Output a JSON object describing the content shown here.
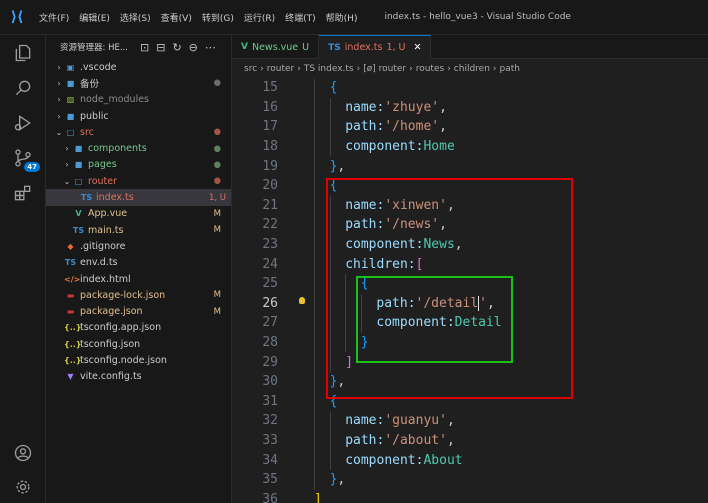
{
  "titlebar": {
    "menu": [
      "文件(F)",
      "编辑(E)",
      "选择(S)",
      "查看(V)",
      "转到(G)",
      "运行(R)",
      "终端(T)",
      "帮助(H)"
    ],
    "title": "index.ts - hello_vue3 - Visual Studio Code"
  },
  "activity_bar": {
    "items": [
      "explorer-icon",
      "search-icon",
      "run-debug-icon",
      "source-control-icon",
      "extensions-icon",
      "account-icon",
      "settings-gear-icon"
    ],
    "scm_badge": "47"
  },
  "explorer": {
    "title": "资源管理器: HE...",
    "items": [
      {
        "depth": 1,
        "chevron": "›",
        "icon": "▣",
        "icon_color": "#4e9bd4",
        "label": ".vscode",
        "label_color": "#cccccc",
        "status": "",
        "status_color": "#cccccc"
      },
      {
        "depth": 1,
        "chevron": "›",
        "icon": "■",
        "icon_color": "#4e9bd4",
        "label": "备份",
        "label_color": "#cccccc",
        "status": "●",
        "status_color": "#6b6b6b"
      },
      {
        "depth": 1,
        "chevron": "›",
        "icon": "▨",
        "icon_color": "#8dc149",
        "label": "node_modules",
        "label_color": "#8c8c8c",
        "status": "",
        "status_color": "#cccccc"
      },
      {
        "depth": 1,
        "chevron": "›",
        "icon": "■",
        "icon_color": "#4e9bd4",
        "label": "public",
        "label_color": "#cccccc",
        "status": "",
        "status_color": "#cccccc"
      },
      {
        "depth": 1,
        "chevron": "⌄",
        "icon": "□",
        "icon_color": "#4e9bd4",
        "label": "src",
        "label_color": "#e2705f",
        "status": "●",
        "status_color": "#a0534a"
      },
      {
        "depth": 2,
        "chevron": "›",
        "icon": "■",
        "icon_color": "#4e9bd4",
        "label": "components",
        "label_color": "#73c991",
        "status": "●",
        "status_color": "#5f7f5f"
      },
      {
        "depth": 2,
        "chevron": "›",
        "icon": "■",
        "icon_color": "#4e9bd4",
        "label": "pages",
        "label_color": "#73c991",
        "status": "●",
        "status_color": "#5f7f5f"
      },
      {
        "depth": 2,
        "chevron": "⌄",
        "icon": "□",
        "icon_color": "#4e9bd4",
        "label": "router",
        "label_color": "#e2705f",
        "status": "●",
        "status_color": "#a0534a"
      },
      {
        "depth": 3,
        "chevron": "",
        "icon": "TS",
        "icon_color": "#3c8ccf",
        "label": "index.ts",
        "label_color": "#e2705f",
        "status": "1, U",
        "status_color": "#e2705f",
        "selected": true
      },
      {
        "depth": 2,
        "chevron": "",
        "icon": "V",
        "icon_color": "#41b883",
        "label": "App.vue",
        "label_color": "#e2c08d",
        "status": "M",
        "status_color": "#e2c08d"
      },
      {
        "depth": 2,
        "chevron": "",
        "icon": "TS",
        "icon_color": "#3c8ccf",
        "label": "main.ts",
        "label_color": "#e2c08d",
        "status": "M",
        "status_color": "#e2c08d"
      },
      {
        "depth": 1,
        "chevron": "",
        "icon": "◆",
        "icon_color": "#e8683a",
        "label": ".gitignore",
        "label_color": "#cccccc",
        "status": "",
        "status_color": "#cccccc"
      },
      {
        "depth": 1,
        "chevron": "",
        "icon": "TS",
        "icon_color": "#3c8ccf",
        "label": "env.d.ts",
        "label_color": "#cccccc",
        "status": "",
        "status_color": "#cccccc"
      },
      {
        "depth": 1,
        "chevron": "",
        "icon": "</>",
        "icon_color": "#e37933",
        "label": "index.html",
        "label_color": "#cccccc",
        "status": "",
        "status_color": "#cccccc"
      },
      {
        "depth": 1,
        "chevron": "",
        "icon": "▬",
        "icon_color": "#cb3837",
        "label": "package-lock.json",
        "label_color": "#e2c08d",
        "status": "M",
        "status_color": "#e2c08d"
      },
      {
        "depth": 1,
        "chevron": "",
        "icon": "▬",
        "icon_color": "#cb3837",
        "label": "package.json",
        "label_color": "#e2c08d",
        "status": "M",
        "status_color": "#e2c08d"
      },
      {
        "depth": 1,
        "chevron": "",
        "icon": "{..}",
        "icon_color": "#cbcb41",
        "label": "tsconfig.app.json",
        "label_color": "#cccccc",
        "status": "",
        "status_color": "#cccccc"
      },
      {
        "depth": 1,
        "chevron": "",
        "icon": "{..}",
        "icon_color": "#cbcb41",
        "label": "tsconfig.json",
        "label_color": "#cccccc",
        "status": "",
        "status_color": "#cccccc"
      },
      {
        "depth": 1,
        "chevron": "",
        "icon": "{..}",
        "icon_color": "#cbcb41",
        "label": "tsconfig.node.json",
        "label_color": "#cccccc",
        "status": "",
        "status_color": "#cccccc"
      },
      {
        "depth": 1,
        "chevron": "",
        "icon": "▼",
        "icon_color": "#a47cf5",
        "label": "vite.config.ts",
        "label_color": "#cccccc",
        "status": "",
        "status_color": "#cccccc"
      }
    ]
  },
  "tabs": [
    {
      "icon": "V",
      "icon_color": "#41b883",
      "label": "News.vue",
      "status": "U",
      "active": false
    },
    {
      "icon": "TS",
      "icon_color": "#3c8ccf",
      "label": "index.ts",
      "status": "1, U",
      "active": true,
      "close": "✕"
    }
  ],
  "breadcrumb": [
    "src",
    "›",
    "router",
    "›",
    "TS index.ts",
    "›",
    "[ø] router",
    "›",
    "routes",
    "›",
    "children",
    "›",
    "path"
  ],
  "editor": {
    "current_line": 26,
    "lines": [
      {
        "n": 15,
        "indent": 1,
        "tokens": [
          {
            "t": "{",
            "c": "b"
          }
        ]
      },
      {
        "n": 16,
        "indent": 2,
        "tokens": [
          {
            "t": "name:",
            "c": "k"
          },
          {
            "t": "'zhuye'",
            "c": "s"
          },
          {
            "t": ",",
            "c": "w"
          }
        ]
      },
      {
        "n": 17,
        "indent": 2,
        "tokens": [
          {
            "t": "path:",
            "c": "k"
          },
          {
            "t": "'/home'",
            "c": "s"
          },
          {
            "t": ",",
            "c": "w"
          }
        ]
      },
      {
        "n": 18,
        "indent": 2,
        "tokens": [
          {
            "t": "component:",
            "c": "k"
          },
          {
            "t": "Home",
            "c": "t"
          }
        ]
      },
      {
        "n": 19,
        "indent": 1,
        "tokens": [
          {
            "t": "}",
            "c": "b"
          },
          {
            "t": ",",
            "c": "w"
          }
        ]
      },
      {
        "n": 20,
        "indent": 1,
        "tokens": [
          {
            "t": "{",
            "c": "b"
          }
        ]
      },
      {
        "n": 21,
        "indent": 2,
        "tokens": [
          {
            "t": "name:",
            "c": "k"
          },
          {
            "t": "'xinwen'",
            "c": "s"
          },
          {
            "t": ",",
            "c": "w"
          }
        ]
      },
      {
        "n": 22,
        "indent": 2,
        "tokens": [
          {
            "t": "path:",
            "c": "k"
          },
          {
            "t": "'/news'",
            "c": "s"
          },
          {
            "t": ",",
            "c": "w"
          }
        ]
      },
      {
        "n": 23,
        "indent": 2,
        "tokens": [
          {
            "t": "component:",
            "c": "k"
          },
          {
            "t": "News",
            "c": "t"
          },
          {
            "t": ",",
            "c": "w"
          }
        ]
      },
      {
        "n": 24,
        "indent": 2,
        "tokens": [
          {
            "t": "children:",
            "c": "k"
          },
          {
            "t": "[",
            "c": "p"
          }
        ]
      },
      {
        "n": 25,
        "indent": 3,
        "tokens": [
          {
            "t": "{",
            "c": "b"
          }
        ]
      },
      {
        "n": 26,
        "indent": 4,
        "tokens": [
          {
            "t": "path:",
            "c": "k"
          },
          {
            "t": "'/detail",
            "c": "s"
          },
          {
            "t": "|",
            "c": "cursor"
          },
          {
            "t": "'",
            "c": "s"
          },
          {
            "t": ",",
            "c": "w"
          }
        ]
      },
      {
        "n": 27,
        "indent": 4,
        "tokens": [
          {
            "t": "component:",
            "c": "k"
          },
          {
            "t": "Detail",
            "c": "t"
          }
        ]
      },
      {
        "n": 28,
        "indent": 3,
        "tokens": [
          {
            "t": "}",
            "c": "b"
          }
        ]
      },
      {
        "n": 29,
        "indent": 2,
        "tokens": [
          {
            "t": "]",
            "c": "p"
          }
        ]
      },
      {
        "n": 30,
        "indent": 1,
        "tokens": [
          {
            "t": "}",
            "c": "b"
          },
          {
            "t": ",",
            "c": "w"
          }
        ]
      },
      {
        "n": 31,
        "indent": 1,
        "tokens": [
          {
            "t": "{",
            "c": "b"
          }
        ]
      },
      {
        "n": 32,
        "indent": 2,
        "tokens": [
          {
            "t": "name:",
            "c": "k"
          },
          {
            "t": "'guanyu'",
            "c": "s"
          },
          {
            "t": ",",
            "c": "w"
          }
        ]
      },
      {
        "n": 33,
        "indent": 2,
        "tokens": [
          {
            "t": "path:",
            "c": "k"
          },
          {
            "t": "'/about'",
            "c": "s"
          },
          {
            "t": ",",
            "c": "w"
          }
        ]
      },
      {
        "n": 34,
        "indent": 2,
        "tokens": [
          {
            "t": "component:",
            "c": "k"
          },
          {
            "t": "About",
            "c": "t"
          }
        ]
      },
      {
        "n": 35,
        "indent": 1,
        "tokens": [
          {
            "t": "}",
            "c": "b"
          },
          {
            "t": ",",
            "c": "w"
          }
        ]
      },
      {
        "n": 36,
        "indent": 0,
        "tokens": [
          {
            "t": "]",
            "c": "y"
          }
        ]
      }
    ]
  },
  "annotations": {
    "red_box_color": "#e00000",
    "green_box_color": "#19c219"
  }
}
